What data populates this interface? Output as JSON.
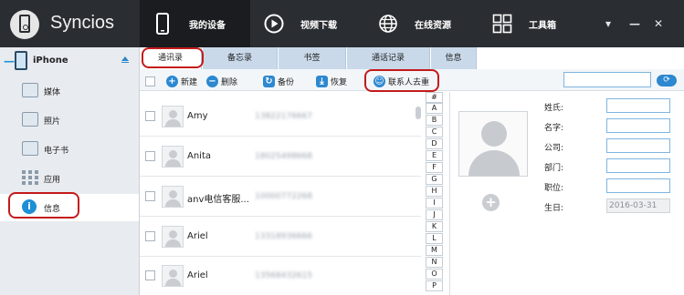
{
  "app": {
    "title": "Syncios"
  },
  "nav": {
    "tabs": [
      {
        "label": "我的设备",
        "icon": "phone-icon"
      },
      {
        "label": "视频下载",
        "icon": "play-icon"
      },
      {
        "label": "在线资源",
        "icon": "globe-icon"
      },
      {
        "label": "工具箱",
        "icon": "grid-icon"
      }
    ],
    "window_controls": [
      "▾",
      "—",
      "✕"
    ]
  },
  "sidebar": {
    "device_name": "iPhone",
    "items": [
      {
        "label": "媒体",
        "icon": "media-icon"
      },
      {
        "label": "照片",
        "icon": "photo-icon"
      },
      {
        "label": "电子书",
        "icon": "ebook-icon"
      },
      {
        "label": "应用",
        "icon": "apps-icon"
      },
      {
        "label": "信息",
        "icon": "info-icon"
      }
    ]
  },
  "subtabs": [
    "通讯录",
    "备忘录",
    "书签",
    "通话记录",
    "信息"
  ],
  "toolbar": {
    "new_label": "新建",
    "delete_label": "删除",
    "backup_label": "备份",
    "restore_label": "恢复",
    "dedupe_label": "联系人去重"
  },
  "contacts": [
    {
      "name": "Amy",
      "phone": "13822176667"
    },
    {
      "name": "Anita",
      "phone": "18025498668"
    },
    {
      "name": "anv电信客服...",
      "phone": "10000772268"
    },
    {
      "name": "Ariel",
      "phone": "13318936666"
    },
    {
      "name": "Ariel",
      "phone": "13568432615"
    }
  ],
  "alphabet": [
    "#",
    "A",
    "B",
    "C",
    "D",
    "E",
    "F",
    "G",
    "H",
    "I",
    "J",
    "K",
    "L",
    "M",
    "N",
    "O",
    "P"
  ],
  "detail": {
    "fields": [
      {
        "label": "姓氏:",
        "value": ""
      },
      {
        "label": "名字:",
        "value": ""
      },
      {
        "label": "公司:",
        "value": ""
      },
      {
        "label": "部门:",
        "value": ""
      },
      {
        "label": "职位:",
        "value": ""
      },
      {
        "label": "生日:",
        "value": "2016-03-31"
      }
    ]
  },
  "colors": {
    "accent": "#2c88d0",
    "highlight_ring": "#c41a1a",
    "topbar": "#2a2d31"
  }
}
